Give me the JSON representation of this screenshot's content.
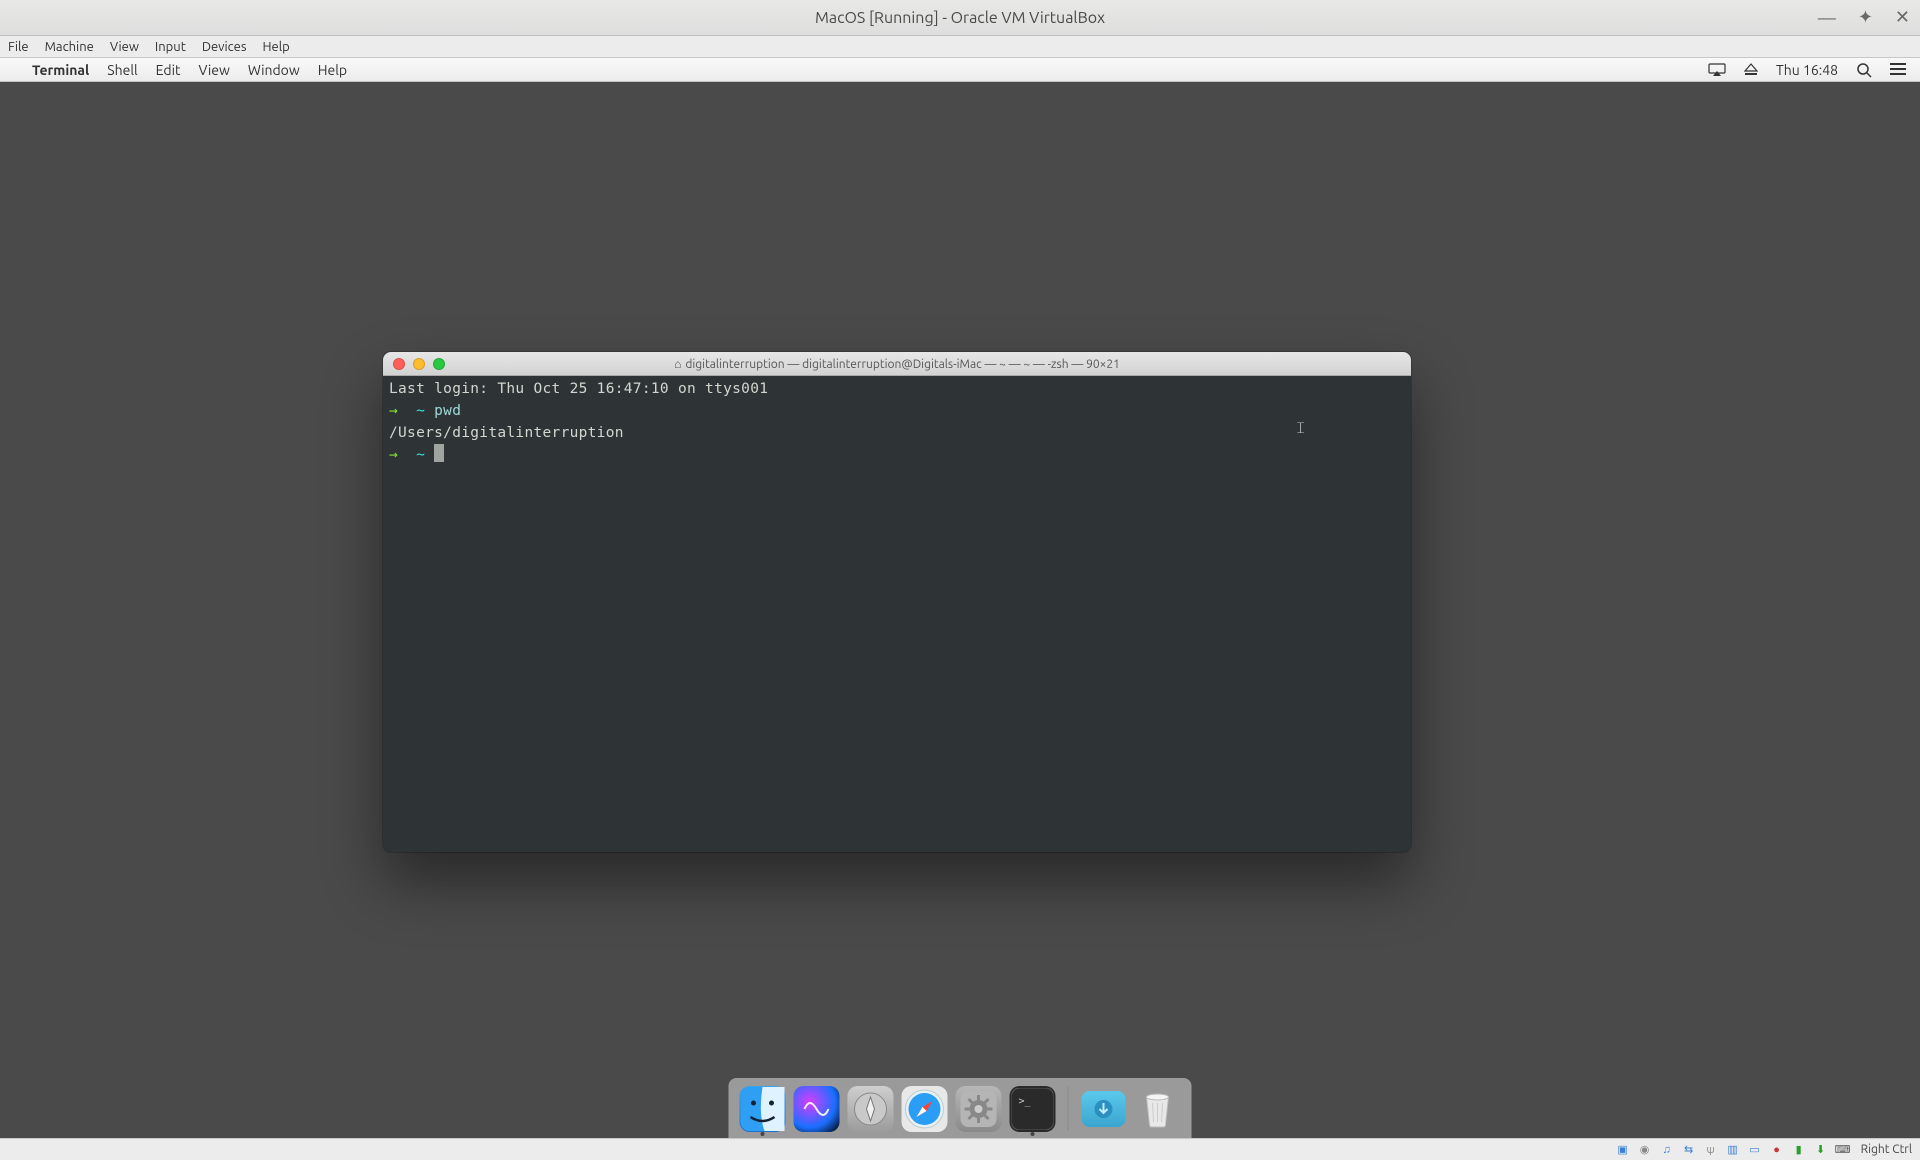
{
  "vbox": {
    "title": "MacOS [Running] - Oracle VM VirtualBox",
    "menu": [
      "File",
      "Machine",
      "View",
      "Input",
      "Devices",
      "Help"
    ],
    "status_text": "Right Ctrl"
  },
  "mac_menu": {
    "app": "Terminal",
    "items": [
      "Shell",
      "Edit",
      "View",
      "Window",
      "Help"
    ],
    "clock": "Thu 16:48"
  },
  "terminal": {
    "title": "digitalinterruption — digitalinterruption@Digitals-iMac — ~ — ~ — -zsh — 90×21",
    "lines": {
      "last_login": "Last login: Thu Oct 25 16:47:10 on ttys001",
      "prompt_arrow": "→",
      "prompt_tilde": "~",
      "cmd1": "pwd",
      "out1": "/Users/digitalinterruption"
    }
  },
  "dock": {
    "items": [
      {
        "name": "Finder"
      },
      {
        "name": "Siri"
      },
      {
        "name": "Launchpad"
      },
      {
        "name": "Safari"
      },
      {
        "name": "System Preferences"
      },
      {
        "name": "Terminal"
      }
    ]
  }
}
